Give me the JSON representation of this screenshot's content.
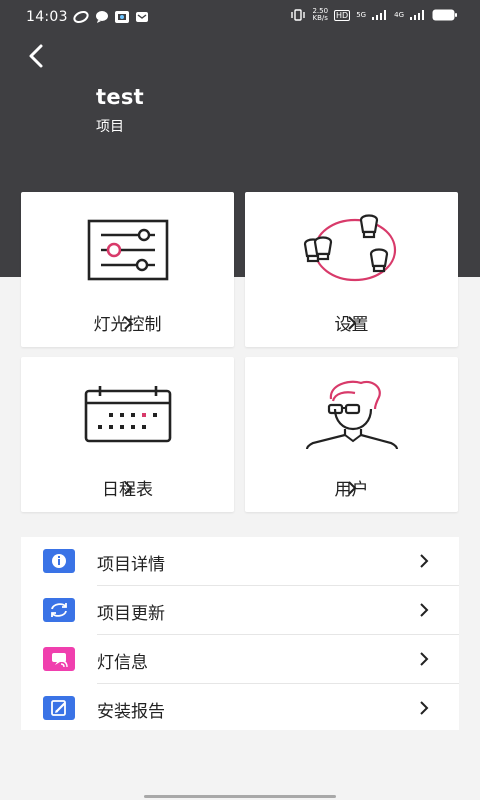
{
  "status_bar": {
    "time": "14:03",
    "net_speed_top": "2.50",
    "net_speed_bottom": "KB/s",
    "hd_tag": "HD",
    "net_5g": "5G",
    "net_4g": "4G"
  },
  "header": {
    "project_name": "test",
    "project_label": "项目"
  },
  "cards": {
    "lighting_control": "灯光控制",
    "settings": "设置",
    "schedule": "日程表",
    "users": "用户"
  },
  "menu": [
    {
      "label": "项目详情",
      "icon": "info-icon",
      "color": "#3a73e6"
    },
    {
      "label": "项目更新",
      "icon": "refresh-icon",
      "color": "#3a73e6"
    },
    {
      "label": "灯信息",
      "icon": "light-info-icon",
      "color": "#f03fae"
    },
    {
      "label": "安装报告",
      "icon": "install-report-icon",
      "color": "#3a73e6"
    }
  ],
  "colors": {
    "header_bg": "#3f3f42",
    "accent_pink": "#d83a6a",
    "blue": "#3a73e6",
    "pink": "#f03fae"
  }
}
